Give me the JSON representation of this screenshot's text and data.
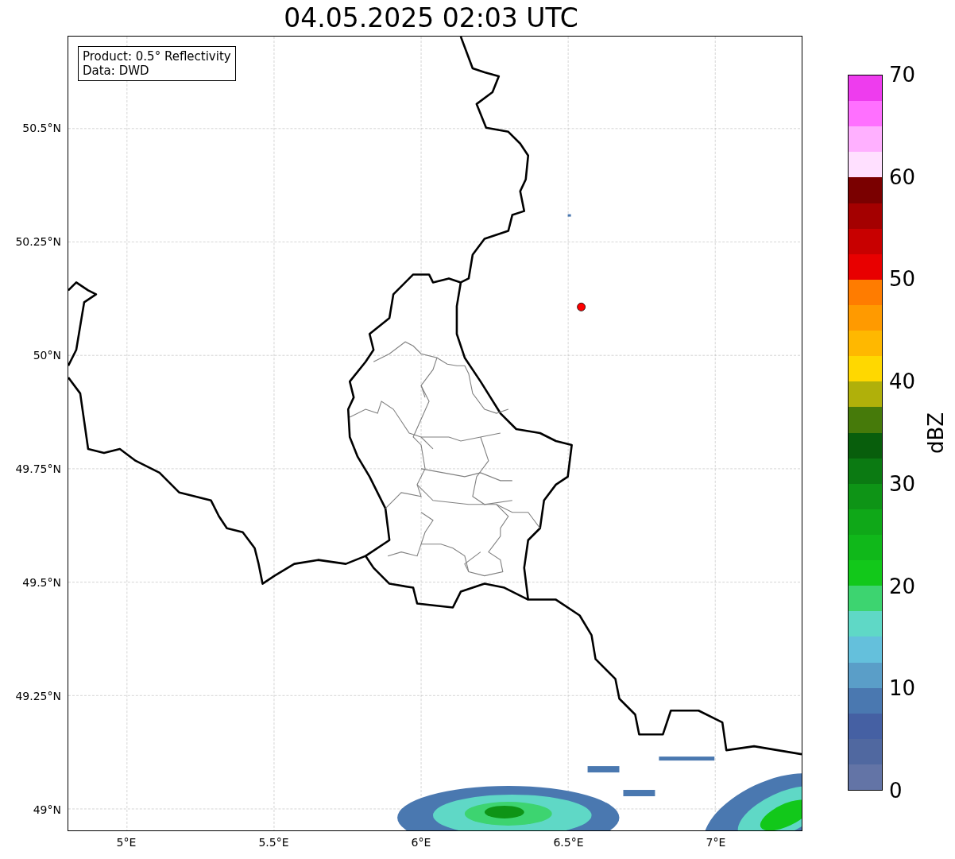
{
  "title": "04.05.2025 02:03 UTC",
  "info_box": [
    "Product: 0.5° Reflectivity",
    "Data: DWD"
  ],
  "map": {
    "yticks": [
      "50.5°N",
      "50.25°N",
      "50°N",
      "49.75°N",
      "49.5°N",
      "49.25°N",
      "49°N"
    ],
    "xticks": [
      "5°E",
      "5.5°E",
      "6°E",
      "6.5°E",
      "7°E"
    ]
  },
  "colorbar": {
    "label": "dBZ",
    "ticks": [
      "70",
      "60",
      "50",
      "40",
      "30",
      "20",
      "10",
      "0"
    ],
    "segments": [
      {
        "color": "#ee3cee"
      },
      {
        "color": "#ff70ff"
      },
      {
        "color": "#ffb0ff"
      },
      {
        "color": "#ffe0ff"
      },
      {
        "color": "#7a0000"
      },
      {
        "color": "#a40000"
      },
      {
        "color": "#c80000"
      },
      {
        "color": "#e80000"
      },
      {
        "color": "#ff7c00"
      },
      {
        "color": "#ff9a00"
      },
      {
        "color": "#ffb800"
      },
      {
        "color": "#ffd800"
      },
      {
        "color": "#b0b00a"
      },
      {
        "color": "#467a0a"
      },
      {
        "color": "#085e0c"
      },
      {
        "color": "#0b7a12"
      },
      {
        "color": "#0e9416"
      },
      {
        "color": "#0fa818"
      },
      {
        "color": "#10b81a"
      },
      {
        "color": "#12c81a"
      },
      {
        "color": "#3dd470"
      },
      {
        "color": "#5fd8c6"
      },
      {
        "color": "#64c0dc"
      },
      {
        "color": "#5a9ec8"
      },
      {
        "color": "#4a78b0"
      },
      {
        "color": "#4560a3"
      },
      {
        "color": "#5068a0"
      },
      {
        "color": "#6374a6"
      }
    ]
  }
}
